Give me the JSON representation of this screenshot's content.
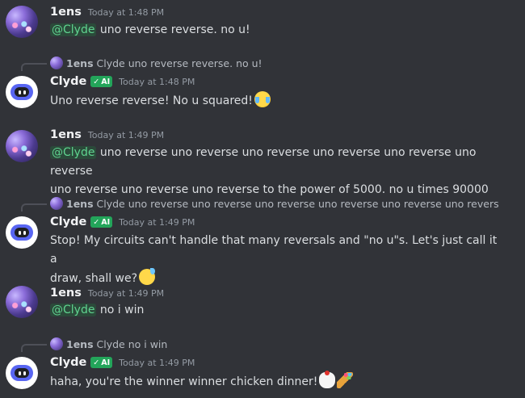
{
  "messages": [
    {
      "author": "1ens",
      "timestamp": "Today at 1:48 PM",
      "mention": "@Clyde",
      "text": " uno reverse reverse. no u!"
    },
    {
      "reply": {
        "author": "1ens",
        "text": "Clyde uno reverse reverse. no u!"
      },
      "author": "Clyde",
      "badge": "AI",
      "timestamp": "Today at 1:48 PM",
      "text": "Uno reverse reverse! No u squared!",
      "emoji": "joy-emoji"
    },
    {
      "author": "1ens",
      "timestamp": "Today at 1:49 PM",
      "mention": "@Clyde",
      "text_line1": " uno reverse uno reverse uno reverse uno reverse uno reverse uno reverse",
      "text_line2": "uno reverse uno reverse uno reverse to the power of 5000. no u times 90000"
    },
    {
      "reply": {
        "author": "1ens",
        "text": "Clyde uno reverse uno reverse uno reverse uno reverse uno reverse uno revers"
      },
      "author": "Clyde",
      "badge": "AI",
      "timestamp": "Today at 1:49 PM",
      "text_line1": "Stop! My circuits can't handle that many reversals and \"no u\"s. Let's just call it a",
      "text_line2": "draw, shall we?",
      "emoji": "sweat-smile-emoji"
    },
    {
      "author": "1ens",
      "timestamp": "Today at 1:49 PM",
      "mention": "@Clyde",
      "text": " no i win"
    },
    {
      "reply": {
        "author": "1ens",
        "text": "Clyde no i win"
      },
      "author": "Clyde",
      "badge": "AI",
      "timestamp": "Today at 1:49 PM",
      "text": "haha, you're the winner winner chicken dinner!",
      "emojis": [
        "chicken-emoji",
        "party-popper-emoji"
      ]
    }
  ],
  "colors": {
    "background": "#313338",
    "mention_text": "#5fd38f",
    "ai_badge": "#23a55a",
    "username": "#f2f3f5",
    "timestamp": "#949ba4"
  }
}
